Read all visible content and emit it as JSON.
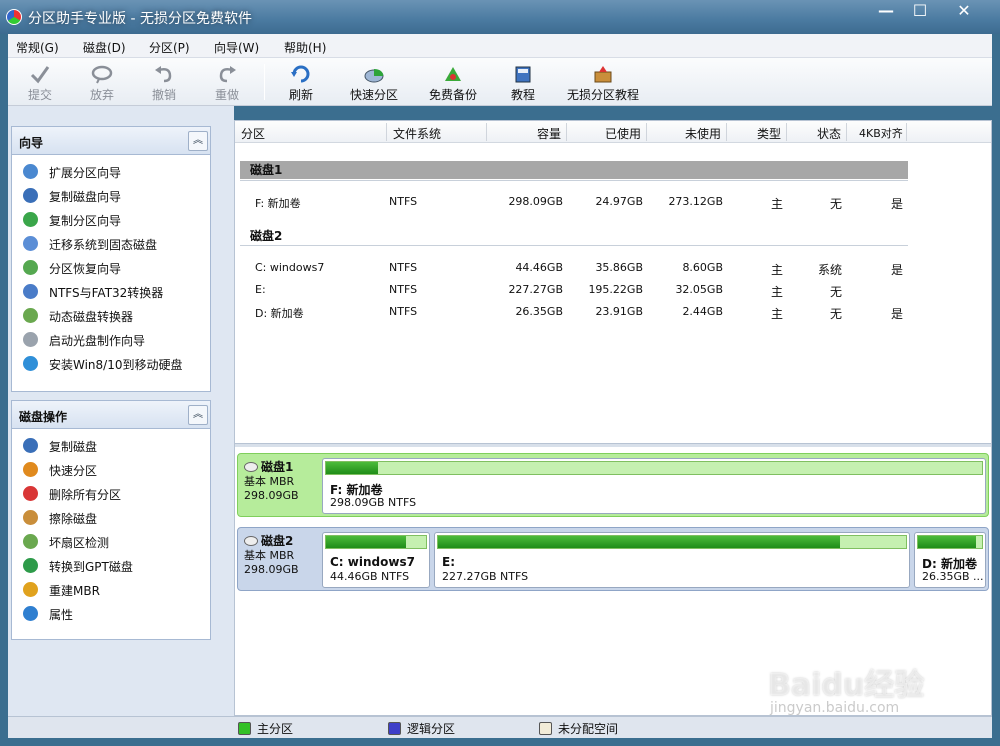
{
  "window": {
    "title": "分区助手专业版 - 无损分区免费软件",
    "min": "—",
    "max": "☐",
    "close": "✕"
  },
  "menu": [
    "常规(G)",
    "磁盘(D)",
    "分区(P)",
    "向导(W)",
    "帮助(H)"
  ],
  "toolbar": {
    "submit": "提交",
    "discard": "放弃",
    "undo": "撤销",
    "redo": "重做",
    "refresh": "刷新",
    "quick_partition": "快速分区",
    "free_backup": "免费备份",
    "tutorial": "教程",
    "lossless_tutorial": "无损分区教程"
  },
  "wizard_panel": {
    "title": "向导",
    "items": [
      "扩展分区向导",
      "复制磁盘向导",
      "复制分区向导",
      "迁移系统到固态磁盘",
      "分区恢复向导",
      "NTFS与FAT32转换器",
      "动态磁盘转换器",
      "启动光盘制作向导",
      "安装Win8/10到移动硬盘"
    ]
  },
  "disk_ops_panel": {
    "title": "磁盘操作",
    "items": [
      "复制磁盘",
      "快速分区",
      "删除所有分区",
      "擦除磁盘",
      "坏扇区检测",
      "转换到GPT磁盘",
      "重建MBR",
      "属性"
    ]
  },
  "columns": [
    "分区",
    "文件系统",
    "容量",
    "已使用",
    "未使用",
    "类型",
    "状态",
    "4KB对齐"
  ],
  "disks": [
    {
      "label": "磁盘1",
      "partitions": [
        {
          "name": "F: 新加卷",
          "fs": "NTFS",
          "capacity": "298.09GB",
          "used": "24.97GB",
          "unused": "273.12GB",
          "type": "主",
          "status": "无",
          "align": "是"
        }
      ]
    },
    {
      "label": "磁盘2",
      "partitions": [
        {
          "name": "C: windows7",
          "fs": "NTFS",
          "capacity": "44.46GB",
          "used": "35.86GB",
          "unused": "8.60GB",
          "type": "主",
          "status": "系统",
          "align": "是"
        },
        {
          "name": "E:",
          "fs": "NTFS",
          "capacity": "227.27GB",
          "used": "195.22GB",
          "unused": "32.05GB",
          "type": "主",
          "status": "无",
          "align": ""
        },
        {
          "name": "D: 新加卷",
          "fs": "NTFS",
          "capacity": "26.35GB",
          "used": "23.91GB",
          "unused": "2.44GB",
          "type": "主",
          "status": "无",
          "align": "是"
        }
      ]
    }
  ],
  "disk_map": [
    {
      "name": "磁盘1",
      "kind": "基本 MBR",
      "size": "298.09GB",
      "parts": [
        {
          "name": "F: 新加卷",
          "detail": "298.09GB NTFS",
          "used_fraction": 0.08
        }
      ]
    },
    {
      "name": "磁盘2",
      "kind": "基本 MBR",
      "size": "298.09GB",
      "parts": [
        {
          "name": "C: windows7",
          "detail": "44.46GB NTFS",
          "used_fraction": 0.8
        },
        {
          "name": "E:",
          "detail": "227.27GB NTFS",
          "used_fraction": 0.86
        },
        {
          "name": "D: 新加卷",
          "detail": "26.35GB ...",
          "used_fraction": 0.91
        }
      ]
    }
  ],
  "legend": {
    "primary": "主分区",
    "logical": "逻辑分区",
    "unallocated": "未分配空间"
  },
  "colors": {
    "primary": "#33c026",
    "logical": "#3d3ec8",
    "unallocated": "#f2ecd8"
  },
  "watermark": {
    "brand": "Baidu经验",
    "url": "jingyan.baidu.com"
  }
}
